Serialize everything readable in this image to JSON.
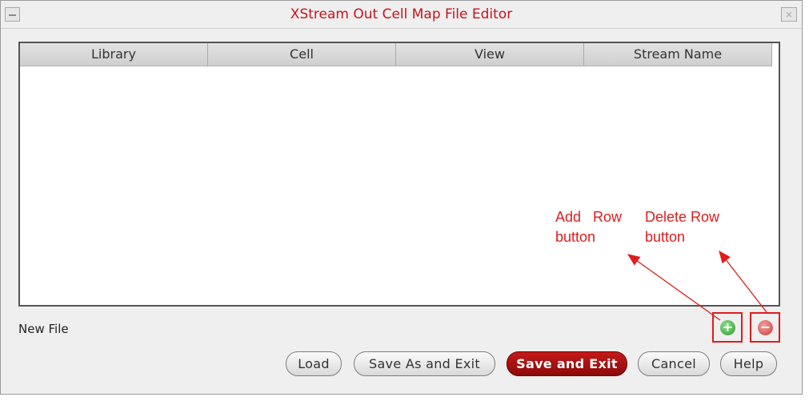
{
  "window": {
    "title": "XStream Out Cell Map File Editor",
    "close_glyph": "⨯"
  },
  "table": {
    "columns": [
      "Library",
      "Cell",
      "View",
      "Stream Name"
    ]
  },
  "status": {
    "text": "New File"
  },
  "annotations": {
    "add_row": "Add   Row\nbutton",
    "delete_row": "Delete Row\nbutton"
  },
  "buttons": {
    "load": "Load",
    "save_as_exit": "Save As and Exit",
    "save_exit": "Save and Exit",
    "cancel": "Cancel",
    "help": "Help"
  },
  "colors": {
    "title": "#c8141e",
    "annotation": "#e01c1c",
    "primary_button": "#a81010",
    "add_icon": "#3fae3f",
    "delete_icon": "#d9534f"
  }
}
